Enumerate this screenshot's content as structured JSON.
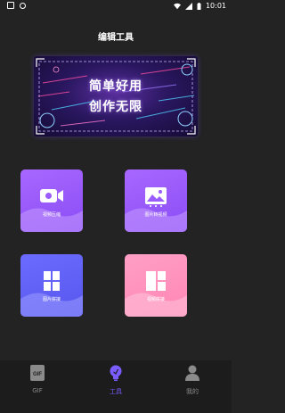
{
  "status_bar": {
    "time": "10:01",
    "icons": [
      "gif-icon",
      "record-icon",
      "wifi-icon",
      "signal-icon",
      "battery-icon"
    ]
  },
  "header": {
    "title": "编辑工具"
  },
  "banner": {
    "line1": "简单好用",
    "line2": "创作无限"
  },
  "tools": [
    {
      "label": "视频压缩",
      "icon": "video-camera-icon",
      "color": "#9a5cff"
    },
    {
      "label": "图片转视频",
      "icon": "image-icon",
      "color": "#9a5cff"
    },
    {
      "label": "图片拼接",
      "icon": "grid-icon",
      "color": "#6262f5"
    },
    {
      "label": "视频拼接",
      "icon": "layout-icon",
      "color": "#ff93bd"
    }
  ],
  "bottom_nav": {
    "items": [
      {
        "label": "GIF",
        "icon": "gif-icon",
        "active": false
      },
      {
        "label": "工具",
        "icon": "bulb-icon",
        "active": true
      },
      {
        "label": "我的",
        "icon": "user-icon",
        "active": false
      }
    ],
    "active_color": "#7b5cff"
  }
}
